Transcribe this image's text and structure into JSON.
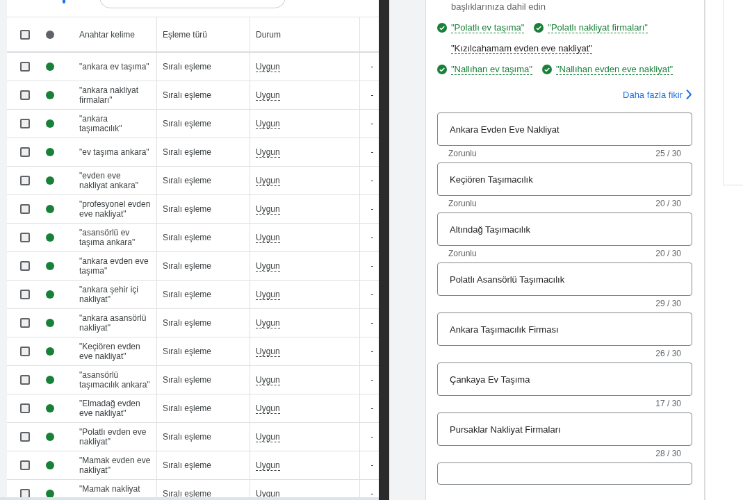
{
  "table": {
    "all_selected": false,
    "columns": [
      "Anahtar kelime",
      "Eşleme türü",
      "Durum"
    ],
    "rows": [
      {
        "keyword": "\"ankara ev taşıma\"",
        "match": "Sıralı eşleme",
        "status": "Uygun",
        "selected": false,
        "color": "#188038"
      },
      {
        "keyword": "\"ankara nakliyat firmaları\"",
        "match": "Sıralı eşleme",
        "status": "Uygun",
        "selected": false,
        "color": "#188038"
      },
      {
        "keyword": "\"ankara taşımacılık\"",
        "match": "Sıralı eşleme",
        "status": "Uygun",
        "selected": false,
        "color": "#188038"
      },
      {
        "keyword": "\"ev taşıma ankara\"",
        "match": "Sıralı eşleme",
        "status": "Uygun",
        "selected": false,
        "color": "#188038"
      },
      {
        "keyword": "\"evden eve nakliyat ankara\"",
        "match": "Sıralı eşleme",
        "status": "Uygun",
        "selected": false,
        "color": "#188038"
      },
      {
        "keyword": "\"profesyonel evden eve nakliyat\"",
        "match": "Sıralı eşleme",
        "status": "Uygun",
        "selected": false,
        "color": "#188038"
      },
      {
        "keyword": "\"asansörlü ev taşıma ankara\"",
        "match": "Sıralı eşleme",
        "status": "Uygun",
        "selected": false,
        "color": "#188038"
      },
      {
        "keyword": "\"ankara evden eve taşıma\"",
        "match": "Sıralı eşleme",
        "status": "Uygun",
        "selected": false,
        "color": "#188038"
      },
      {
        "keyword": "\"ankara şehir içi nakliyat\"",
        "match": "Sıralı eşleme",
        "status": "Uygun",
        "selected": false,
        "color": "#188038"
      },
      {
        "keyword": "\"ankara asansörlü nakliyat\"",
        "match": "Sıralı eşleme",
        "status": "Uygun",
        "selected": false,
        "color": "#188038"
      },
      {
        "keyword": "\"Keçiören evden eve nakliyat\"",
        "match": "Sıralı eşleme",
        "status": "Uygun",
        "selected": false,
        "color": "#188038"
      },
      {
        "keyword": "\"asansörlü taşımacılık ankara\"",
        "match": "Sıralı eşleme",
        "status": "Uygun",
        "selected": false,
        "color": "#188038"
      },
      {
        "keyword": "\"Elmadağ evden eve nakliyat\"",
        "match": "Sıralı eşleme",
        "status": "Uygun",
        "selected": false,
        "color": "#188038"
      },
      {
        "keyword": "\"Polatlı evden eve nakliyat\"",
        "match": "Sıralı eşleme",
        "status": "Uygun",
        "selected": false,
        "color": "#188038"
      },
      {
        "keyword": "\"Mamak evden eve nakliyat\"",
        "match": "Sıralı eşleme",
        "status": "Uygun",
        "selected": false,
        "color": "#188038"
      },
      {
        "keyword": "\"Mamak nakliyat",
        "match": "Sıralı eşleme",
        "status": "Uygun",
        "selected": false,
        "color": "#188038"
      }
    ]
  },
  "panel": {
    "intro": "başlıklarınıza dahil edin",
    "suggestions": [
      [
        {
          "text": "\"Polatlı ev taşıma\"",
          "added": true
        },
        {
          "text": "\"Polatlı nakliyat firmaları\"",
          "added": true
        }
      ],
      [
        {
          "text": "\"Kızılcahamam evden eve nakliyat\"",
          "added": false
        }
      ],
      [
        {
          "text": "\"Nallıhan ev taşıma\"",
          "added": true
        },
        {
          "text": "\"Nallıhan evden eve nakliyat\"",
          "added": true
        }
      ]
    ],
    "more_link": "Daha fazla fikir",
    "headlines": [
      {
        "value": "Ankara Evden Eve Nakliyat",
        "helper": "Zorunlu",
        "count": "25 / 30"
      },
      {
        "value": "Keçiören Taşımacılık",
        "helper": "Zorunlu",
        "count": "20 / 30"
      },
      {
        "value": "Altındağ Taşımacılık",
        "helper": "Zorunlu",
        "count": "20 / 30"
      },
      {
        "value": "Polatlı Asansörlü Taşımacılık",
        "count": "29 / 30"
      },
      {
        "value": "Ankara Taşımacılık Firması",
        "count": "26 / 30"
      },
      {
        "value": "Çankaya Ev Taşıma",
        "count": "17 / 30"
      },
      {
        "value": "Pursaklar Nakliyat Firmaları",
        "count": "28 / 30"
      }
    ]
  }
}
